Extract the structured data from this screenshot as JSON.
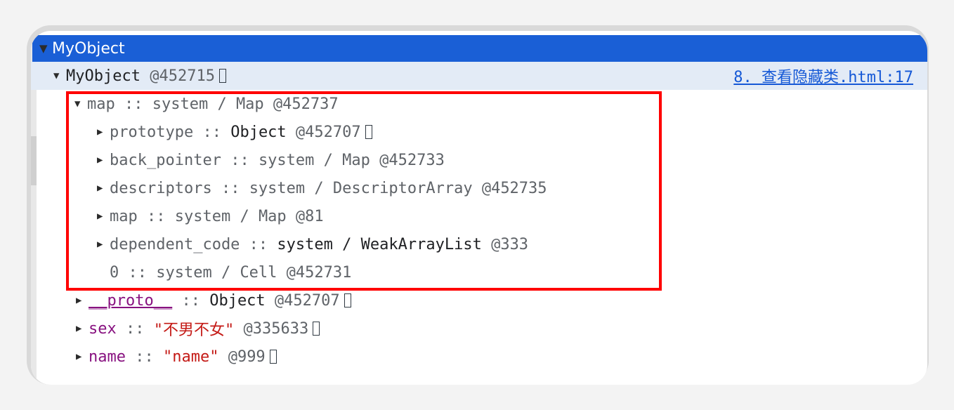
{
  "header": {
    "title": "MyObject"
  },
  "root": {
    "label": "MyObject",
    "id": "@452715",
    "source_link": "8. 查看隐藏类.html:17"
  },
  "map": {
    "name": "map",
    "sep": " :: ",
    "type": "system / Map",
    "id": " @452737",
    "children": [
      {
        "name": "prototype",
        "sep": " :: ",
        "type": "Object",
        "id": " @452707"
      },
      {
        "name": "back_pointer",
        "sep": " :: ",
        "type": "system / Map",
        "id": " @452733"
      },
      {
        "name": "descriptors",
        "sep": " :: ",
        "type": "system / DescriptorArray",
        "id": " @452735"
      },
      {
        "name": "map",
        "sep": " :: ",
        "type": "system / Map",
        "id": " @81"
      },
      {
        "name": "dependent_code",
        "sep": " :: ",
        "type": "system / WeakArrayList",
        "id": " @333"
      },
      {
        "name": "0",
        "sep": " :: ",
        "type": "system / Cell",
        "id": " @452731"
      }
    ]
  },
  "props": [
    {
      "name": "__proto__",
      "sep": " :: ",
      "value": "Object",
      "id": " @452707"
    },
    {
      "name": "sex",
      "sep": " :: ",
      "value": "\"不男不女\"",
      "id": " @335633"
    },
    {
      "name": "name",
      "sep": " :: ",
      "value": "\"name\"",
      "id": " @999"
    }
  ],
  "colors": {
    "header_bg": "#1a5fd6",
    "selected_row_bg": "#e3ebf6",
    "highlight_border": "#ff0000",
    "property_name": "#881280",
    "string_value": "#c41a16",
    "link": "#1558d6"
  },
  "icons": {
    "expanded": "triangle-down-icon",
    "collapsed": "triangle-right-icon",
    "reveal": "reveal-box-icon"
  }
}
